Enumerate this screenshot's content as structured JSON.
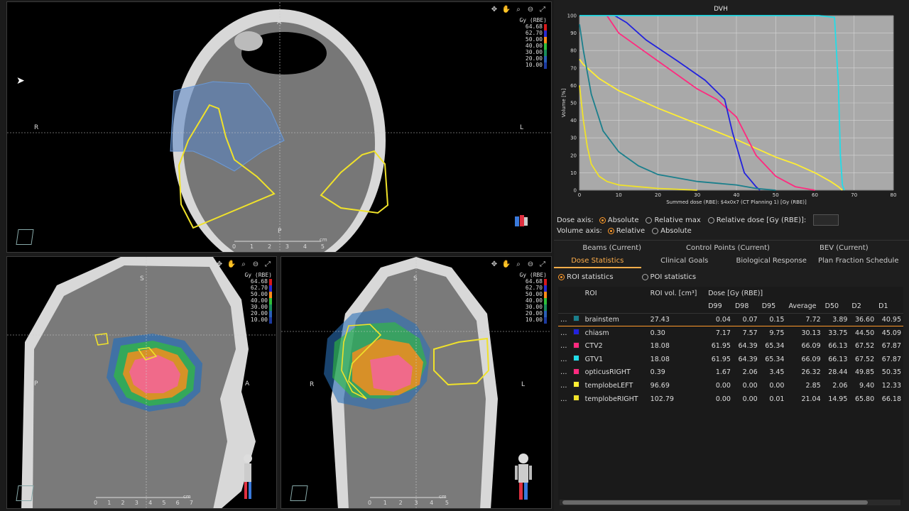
{
  "colorbar": {
    "unit": "Gy (RBE)",
    "levels": [
      {
        "label": "64.68",
        "color": "#d7191c"
      },
      {
        "label": "62.70",
        "color": "#2b2bd0"
      },
      {
        "label": "50.00",
        "color": "#ff8c1a"
      },
      {
        "label": "40.00",
        "color": "#2fbf3b"
      },
      {
        "label": "30.00",
        "color": "#1a8c5a"
      },
      {
        "label": "20.00",
        "color": "#2a5fb5"
      },
      {
        "label": "10.00",
        "color": "#1c3aa0"
      }
    ]
  },
  "axial": {
    "label_a": "A",
    "label_r": "R",
    "label_l": "L",
    "label_p": "P",
    "scale_unit": "cm",
    "ticks": [
      "0",
      "1",
      "2",
      "3",
      "4",
      "5"
    ]
  },
  "sagittal": {
    "label_s": "S",
    "label_p": "P",
    "label_a": "A",
    "scale_unit": "cm",
    "ticks": [
      "0",
      "1",
      "2",
      "3",
      "4",
      "5",
      "6",
      "7"
    ]
  },
  "coronal": {
    "label_s": "S",
    "label_r": "R",
    "label_l": "L",
    "scale_unit": "cm",
    "ticks": [
      "0",
      "1",
      "2",
      "3",
      "4",
      "5"
    ]
  },
  "dvh": {
    "title": "DVH",
    "xlabel": "Summed dose (RBE): $4x0x7 (CT Planning 1) [Gy (RBE)]",
    "ylabel": "Volume [%]"
  },
  "chart_data": {
    "type": "line",
    "title": "DVH",
    "xlabel": "Summed dose (RBE): $4x0x7 (CT Planning 1) [Gy (RBE)]",
    "ylabel": "Volume [%]",
    "xlim": [
      0,
      80
    ],
    "ylim": [
      0,
      100
    ],
    "xticks": [
      0,
      10,
      20,
      30,
      40,
      50,
      60,
      70,
      80
    ],
    "yticks": [
      0,
      10,
      20,
      30,
      40,
      50,
      60,
      70,
      80,
      90,
      100
    ],
    "grid": true,
    "series": [
      {
        "color": "#ffee33",
        "points": [
          [
            0,
            75
          ],
          [
            1,
            72
          ],
          [
            5,
            64
          ],
          [
            10,
            57
          ],
          [
            20,
            47
          ],
          [
            30,
            38
          ],
          [
            40,
            29
          ],
          [
            50,
            19
          ],
          [
            55,
            15
          ],
          [
            60,
            10
          ],
          [
            64,
            5
          ],
          [
            66,
            2
          ],
          [
            67,
            0
          ]
        ]
      },
      {
        "color": "#ff2a7f",
        "points": [
          [
            7,
            100
          ],
          [
            10,
            90
          ],
          [
            15,
            82
          ],
          [
            20,
            74
          ],
          [
            25,
            66
          ],
          [
            30,
            58
          ],
          [
            35,
            52
          ],
          [
            40,
            42
          ],
          [
            45,
            20
          ],
          [
            50,
            8
          ],
          [
            55,
            2
          ],
          [
            60,
            0
          ]
        ]
      },
      {
        "color": "#2222dd",
        "points": [
          [
            9,
            100
          ],
          [
            12,
            96
          ],
          [
            17,
            86
          ],
          [
            25,
            74
          ],
          [
            32,
            63
          ],
          [
            37,
            52
          ],
          [
            39,
            33
          ],
          [
            42,
            10
          ],
          [
            45,
            2
          ],
          [
            46,
            0
          ]
        ]
      },
      {
        "color": "#22dde8",
        "points": [
          [
            0,
            100
          ],
          [
            61,
            100
          ],
          [
            65,
            99
          ],
          [
            66,
            60
          ],
          [
            66.5,
            20
          ],
          [
            67,
            3
          ],
          [
            67.5,
            0
          ]
        ]
      },
      {
        "color": "#1a7f8c",
        "points": [
          [
            0,
            95
          ],
          [
            1,
            80
          ],
          [
            3,
            55
          ],
          [
            6,
            34
          ],
          [
            10,
            22
          ],
          [
            15,
            14
          ],
          [
            20,
            9
          ],
          [
            30,
            5
          ],
          [
            40,
            3
          ],
          [
            45,
            1
          ],
          [
            50,
            0
          ]
        ]
      },
      {
        "color": "#f0e22a",
        "points": [
          [
            0,
            60
          ],
          [
            1,
            40
          ],
          [
            2,
            25
          ],
          [
            3,
            15
          ],
          [
            5,
            8
          ],
          [
            7,
            5
          ],
          [
            10,
            3
          ],
          [
            20,
            1
          ],
          [
            30,
            0
          ]
        ]
      }
    ]
  },
  "dose_axis": {
    "label": "Dose axis:",
    "options": [
      "Absolute",
      "Relative max",
      "Relative dose [Gy (RBE)]:"
    ],
    "selected": 0
  },
  "volume_axis": {
    "label": "Volume axis:",
    "options": [
      "Relative",
      "Absolute"
    ],
    "selected": 0
  },
  "tabs_top": [
    "Beams (Current)",
    "Control Points (Current)",
    "BEV (Current)"
  ],
  "tabs_bottom": [
    "Dose Statistics",
    "Clinical Goals",
    "Biological Response",
    "Plan Fraction Schedule"
  ],
  "stats_mode": {
    "options": [
      "ROI statistics",
      "POI statistics"
    ],
    "selected": 0
  },
  "table": {
    "header_top": [
      "ROI",
      "ROI vol. [cm³]",
      "Dose [Gy (RBE)]"
    ],
    "columns": [
      "D99",
      "D98",
      "D95",
      "Average",
      "D50",
      "D2",
      "D1"
    ],
    "rows": [
      {
        "color": "#1a7f8c",
        "name": "brainstem",
        "vol": "27.43",
        "vals": [
          "0.04",
          "0.07",
          "0.15",
          "7.72",
          "3.89",
          "36.60",
          "40.95"
        ]
      },
      {
        "color": "#2222dd",
        "name": "chiasm",
        "vol": "0.30",
        "vals": [
          "7.17",
          "7.57",
          "9.75",
          "30.13",
          "33.75",
          "44.50",
          "45.09"
        ]
      },
      {
        "color": "#ff2a7f",
        "name": "CTV2",
        "vol": "18.08",
        "vals": [
          "61.95",
          "64.39",
          "65.34",
          "66.09",
          "66.13",
          "67.52",
          "67.87"
        ]
      },
      {
        "color": "#22dde8",
        "name": "GTV1",
        "vol": "18.08",
        "vals": [
          "61.95",
          "64.39",
          "65.34",
          "66.09",
          "66.13",
          "67.52",
          "67.87"
        ]
      },
      {
        "color": "#ff2a7f",
        "name": "opticusRIGHT",
        "vol": "0.39",
        "vals": [
          "1.67",
          "2.06",
          "3.45",
          "26.32",
          "28.44",
          "49.85",
          "50.35"
        ]
      },
      {
        "color": "#ffee33",
        "name": "templobeLEFT",
        "vol": "96.69",
        "vals": [
          "0.00",
          "0.00",
          "0.00",
          "2.85",
          "2.06",
          "9.40",
          "12.33"
        ]
      },
      {
        "color": "#f0e22a",
        "name": "templobeRIGHT",
        "vol": "102.79",
        "vals": [
          "0.00",
          "0.00",
          "0.01",
          "21.04",
          "14.95",
          "65.80",
          "66.18"
        ]
      }
    ]
  }
}
